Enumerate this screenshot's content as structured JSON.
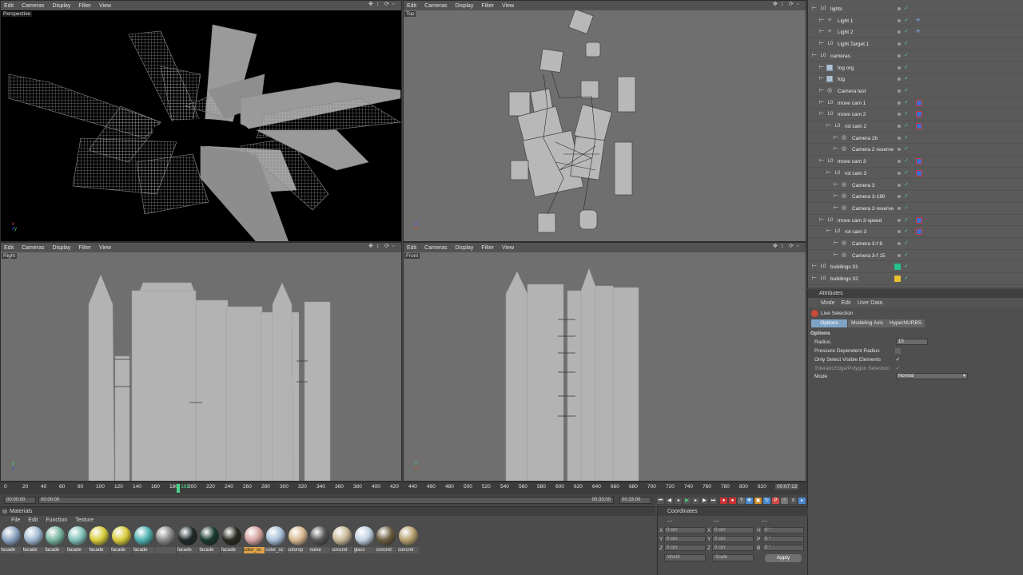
{
  "viewport_menu": [
    "Edit",
    "Cameras",
    "Display",
    "Filter",
    "View"
  ],
  "viewports": {
    "perspective": {
      "label": "Perspective"
    },
    "top": {
      "label": "Top"
    },
    "right": {
      "label": "Right"
    },
    "front": {
      "label": "Front"
    }
  },
  "object_manager": {
    "objects": [
      {
        "name": "lights",
        "level": 0,
        "icon": "null-icon",
        "tag": ""
      },
      {
        "name": "Light 1",
        "level": 1,
        "icon": "light-icon",
        "tag": "target-tag"
      },
      {
        "name": "Light 2",
        "level": 1,
        "icon": "light-icon",
        "tag": "target-tag"
      },
      {
        "name": "Light.Target.1",
        "level": 1,
        "icon": "null-icon",
        "tag": ""
      },
      {
        "name": "cameras",
        "level": 0,
        "icon": "null-icon",
        "tag": ""
      },
      {
        "name": "fog org",
        "level": 1,
        "icon": "environment-icon",
        "tag": ""
      },
      {
        "name": "fog",
        "level": 1,
        "icon": "environment-icon",
        "tag": ""
      },
      {
        "name": "Camera test",
        "level": 1,
        "icon": "camera-icon",
        "tag": ""
      },
      {
        "name": "move cam 1",
        "level": 1,
        "icon": "null-icon",
        "tag": "protection-tag"
      },
      {
        "name": "move cam 2",
        "level": 1,
        "icon": "null-icon",
        "tag": "protection-tag"
      },
      {
        "name": "rot cam 2",
        "level": 2,
        "icon": "null-icon",
        "tag": "protection-tag"
      },
      {
        "name": "Camera 2b",
        "level": 3,
        "icon": "camera-icon",
        "tag": ""
      },
      {
        "name": "Camera 2 reserve",
        "level": 3,
        "icon": "camera-icon",
        "tag": ""
      },
      {
        "name": "move cam 3",
        "level": 1,
        "icon": "null-icon",
        "tag": "protection-tag"
      },
      {
        "name": "rot cam 3",
        "level": 2,
        "icon": "null-icon",
        "tag": "protection-tag"
      },
      {
        "name": "Camera 3",
        "level": 3,
        "icon": "camera-icon",
        "tag": ""
      },
      {
        "name": "Camera 3-180",
        "level": 3,
        "icon": "camera-icon",
        "tag": ""
      },
      {
        "name": "Camera 3 reserve",
        "level": 3,
        "icon": "camera-icon",
        "tag": ""
      },
      {
        "name": "move cam 3-speed",
        "level": 1,
        "icon": "null-icon",
        "tag": "protection-tag"
      },
      {
        "name": "rot cam 3",
        "level": 2,
        "icon": "null-icon",
        "tag": "protection-tag"
      },
      {
        "name": "Camera 3-f 8",
        "level": 3,
        "icon": "camera-icon",
        "tag": ""
      },
      {
        "name": "Camera 3-f 15",
        "level": 3,
        "icon": "camera-icon",
        "tag": ""
      },
      {
        "name": "buildings 01",
        "level": 0,
        "icon": "null-icon",
        "tag": "green-layer-tag"
      },
      {
        "name": "buildings 02",
        "level": 0,
        "icon": "null-icon",
        "tag": "yellow-layer-tag"
      }
    ]
  },
  "attributes": {
    "title": "Attributes",
    "menu": [
      "Mode",
      "Edit",
      "User Data"
    ],
    "tool_name": "Live Selection",
    "tabs": [
      "Options",
      "Modeling Axis",
      "HyperNURBS"
    ],
    "section": "Options",
    "radius_label": "Radius",
    "radius_value": "10",
    "pressure_label": "Pressure Dependent Radius",
    "visible_label": "Only Select Visible Elements",
    "tolerant_label": "Tolerant Edge/Polygon Selection",
    "mode_label": "Mode",
    "mode_value": "Normal"
  },
  "timeline": {
    "ticks": [
      "0",
      "20",
      "40",
      "60",
      "80",
      "100",
      "120",
      "140",
      "160",
      "180",
      "200",
      "220",
      "240",
      "260",
      "280",
      "300",
      "320",
      "340",
      "360",
      "380",
      "400",
      "420",
      "440",
      "460",
      "480",
      "500",
      "520",
      "540",
      "560",
      "580",
      "600",
      "620",
      "640",
      "660",
      "680",
      "700",
      "720",
      "740",
      "760",
      "780",
      "800",
      "820"
    ],
    "current_frame": "188",
    "current_time": "00:07:13",
    "start_time": "00:00:00",
    "range_start": "00:00:00",
    "range_end": "00:33:00",
    "end_time": "00:33:00"
  },
  "materials": {
    "title": "Materials",
    "menu": [
      "File",
      "Edit",
      "Function",
      "Texture"
    ],
    "items": [
      {
        "name": "facade",
        "color": "#8aa4c0"
      },
      {
        "name": "facade",
        "color": "#9fb8d2"
      },
      {
        "name": "facade",
        "color": "#79b5a0"
      },
      {
        "name": "facade",
        "color": "#7fc0b8"
      },
      {
        "name": "facade",
        "color": "#d8cc3a"
      },
      {
        "name": "facade",
        "color": "#d8cc3a"
      },
      {
        "name": "facade",
        "color": "#4fb0b0"
      },
      {
        "name": "",
        "color": "#8a8a8a"
      },
      {
        "name": "facade",
        "color": "#1f2a2a"
      },
      {
        "name": "facade",
        "color": "#1a3a2e"
      },
      {
        "name": "facade",
        "color": "#2a2a22"
      },
      {
        "name": "color_sc",
        "color": "#d6a4a0",
        "selected": true
      },
      {
        "name": "color_sc",
        "color": "#a8c0d8"
      },
      {
        "name": "colorsp",
        "color": "#d8b890"
      },
      {
        "name": "noise",
        "color": "#555555"
      },
      {
        "name": "concret",
        "color": "#c8b898"
      },
      {
        "name": "glass",
        "color": "#c0d0e0"
      },
      {
        "name": "concret",
        "color": "#6a5c40"
      },
      {
        "name": "concret",
        "color": "#b8a070"
      }
    ]
  },
  "coordinates": {
    "title": "Coordinates",
    "dash": "---",
    "rows": [
      {
        "a": "X",
        "av": "0 cm",
        "b": "X",
        "bv": "0 cm",
        "c": "H",
        "cv": "0 °"
      },
      {
        "a": "Y",
        "av": "0 cm",
        "b": "Y",
        "bv": "0 cm",
        "c": "P",
        "cv": "0 °"
      },
      {
        "a": "Z",
        "av": "0 cm",
        "b": "Z",
        "bv": "0 cm",
        "c": "B",
        "cv": "0 °"
      }
    ],
    "space": "World",
    "scale": "Scale",
    "apply": "Apply"
  },
  "colors": {
    "accent": "#7ea3c5",
    "playhead": "#4cd18a",
    "selection": "#e0a24a"
  }
}
